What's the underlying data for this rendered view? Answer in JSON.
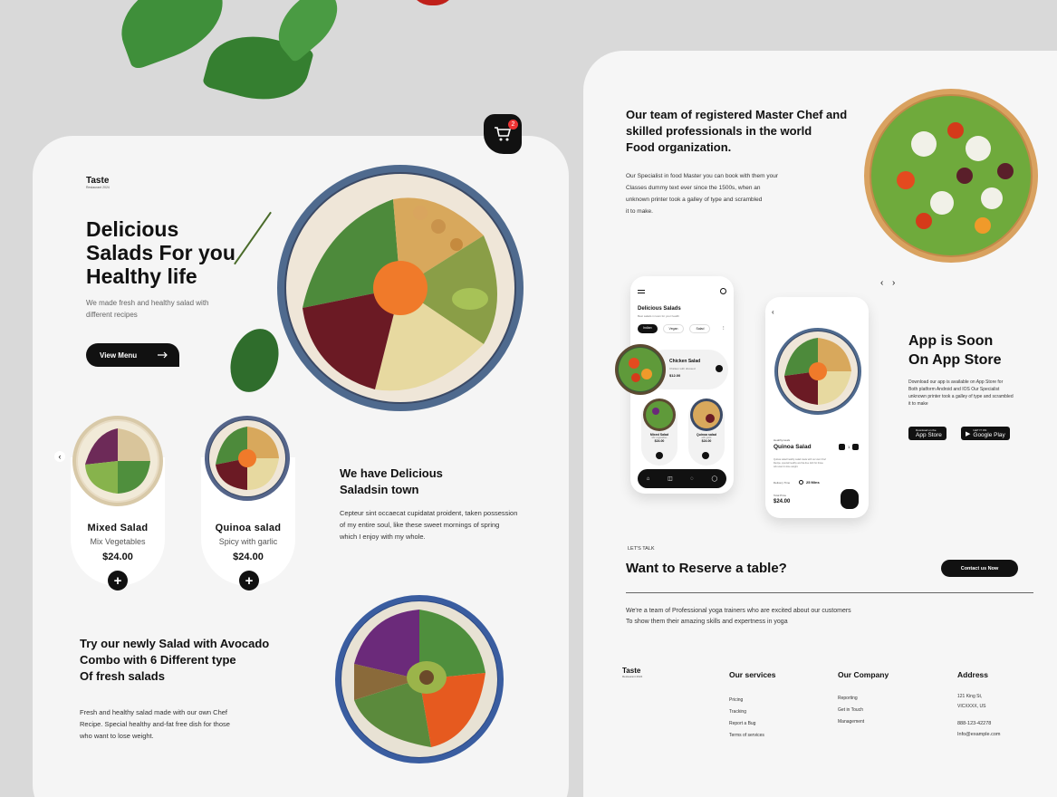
{
  "cart": {
    "count": "2"
  },
  "brand": {
    "name": "Taste",
    "tagline": "Restaurant 2024"
  },
  "hero": {
    "title_lines": [
      "Delicious",
      "Salads For you",
      "Healthy life"
    ],
    "subtitle_lines": [
      "We made fresh and healthy salad with",
      "different recipes"
    ],
    "cta_label": "View Menu"
  },
  "products": [
    {
      "name": "Mixed Salad",
      "desc": "Mix Vegetables",
      "price": "$24.00"
    },
    {
      "name": "Quinoa salad",
      "desc": "Spicy with garlic",
      "price": "$24.00"
    }
  ],
  "delicious": {
    "title_lines": [
      "We have Delicious",
      "Saladsin town"
    ],
    "text_lines": [
      "Cepteur sint occaecat cupidatat proident, taken possession",
      "of my entire soul, like these sweet mornings of spring",
      "which I enjoy with my whole."
    ]
  },
  "avocado": {
    "title_lines": [
      "Try our newly Salad with Avocado",
      "Combo with 6 Different type",
      "Of fresh salads"
    ],
    "text_lines": [
      "Fresh and healthy salad made with our own Chef",
      "Recipe. Special healthy and-fat free dish for those",
      "who want to lose weight."
    ]
  },
  "team": {
    "title_lines": [
      "Our team of registered Master Chef and",
      "skilled professionals in the world",
      "Food organization."
    ],
    "text_lines": [
      "Our Specialist  in  food Master you can book with them your",
      "Classes dummy text ever since the 1500s, when an",
      "unknown printer took a galley of type and scrambled",
      "it to make."
    ]
  },
  "app_screen1": {
    "title": "Delicious Salads",
    "subtitle": "Best salads in town for your health",
    "tabs": [
      "Indian",
      "Vegan",
      "Salad"
    ],
    "featured": {
      "name": "Chicken Salad",
      "desc": "Chicken with dressed",
      "price": "$12.00"
    },
    "items": [
      {
        "name": "Mixed Salad",
        "desc": "Mix vegetables",
        "price": "$24.00"
      },
      {
        "name": "Quinoa salad",
        "desc": "with garlic",
        "price": "$24.00"
      }
    ]
  },
  "app_screen2": {
    "category": "Healthymeals",
    "name": "Quinoa Salad",
    "qty": "1",
    "desc_lines": [
      "Quinoa salad healthy salad made with our own Chef",
      "Recipe, special healthy and fat-free dish for those",
      "who want to lose weight."
    ],
    "delivery_label": "Delivery Time",
    "delivery_time": "25 Mins",
    "total_label": "Total Price",
    "price": "$24.00"
  },
  "app_promo": {
    "title_lines": [
      "App is Soon",
      "On App Store"
    ],
    "text_lines": [
      "Download our app is available on App Store  for",
      "Both platform Android and IOS Our Specialist",
      "unknown printer took a galley of type and scrambled",
      "it to make"
    ],
    "appstore_small": "Download on the",
    "appstore_big": "App Store",
    "googleplay_small": "GET IT ON",
    "googleplay_big": "Google Play"
  },
  "reserve": {
    "eyebrow": "LET'S TALK",
    "title": "Want to Reserve a table?",
    "button": "Contact us Now",
    "text_lines": [
      "We're a team of Professional yoga trainers who are excited about our customers",
      "To show them their amazing skills and expertness in yoga"
    ]
  },
  "footer": {
    "brand": "Taste",
    "brand_sub": "Restaurant 2024",
    "services": {
      "title": "Our services",
      "links": [
        "Pricing",
        "Tracking",
        "Report a Bug",
        "Terms of services"
      ]
    },
    "company": {
      "title": "Our Company",
      "links": [
        "Reporting",
        "Get in Touch",
        "Management"
      ]
    },
    "address": {
      "title": "Address",
      "lines": [
        "121 King St,",
        "VICXXXX, US"
      ],
      "phone": "888-123-42278",
      "email": "Info@example.com"
    }
  },
  "colors": {
    "primary": "#111111",
    "accent_red": "#e33333",
    "card_bg": "#f5f5f5",
    "page_bg": "#d9d9d9"
  }
}
